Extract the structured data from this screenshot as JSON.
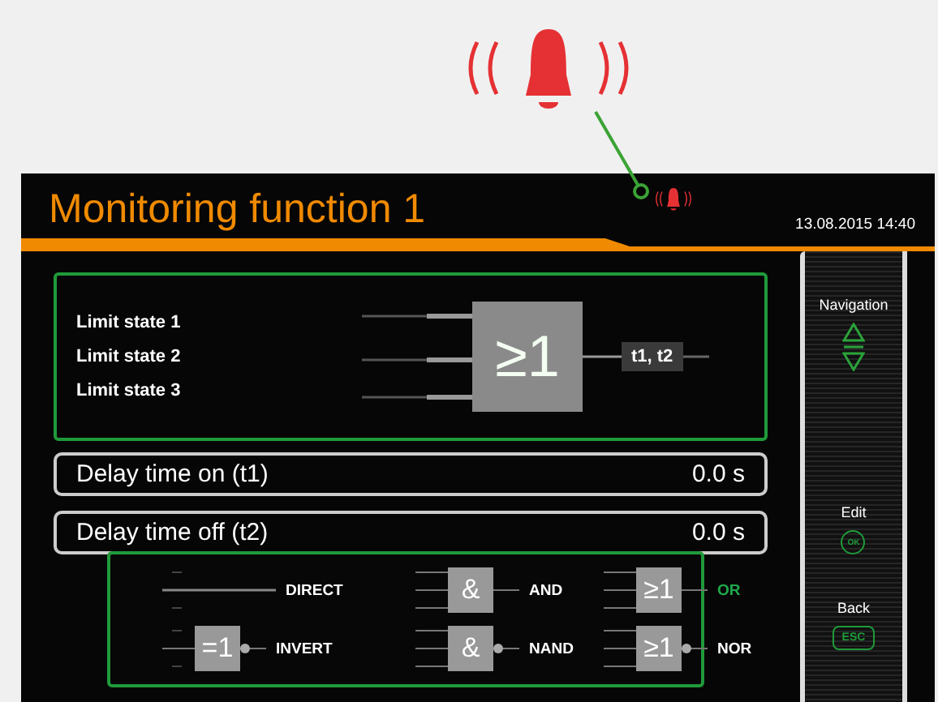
{
  "header": {
    "title": "Monitoring function 1",
    "datetime": "13.08.2015  14:40"
  },
  "logic": {
    "inputs": [
      "Limit state 1",
      "Limit state 2",
      "Limit state 3"
    ],
    "gate": "≥1",
    "output": "t1, t2"
  },
  "parameters": [
    {
      "label": "Delay time on (t1)",
      "value": "0.0 s"
    },
    {
      "label": "Delay time off (t2)",
      "value": "0.0 s"
    }
  ],
  "gate_menu": [
    {
      "kind": "direct",
      "label": "DIRECT",
      "selected": false
    },
    {
      "kind": "multi",
      "symbol": "&",
      "label": "AND",
      "negated": false,
      "selected": false
    },
    {
      "kind": "multi",
      "symbol": "≥1",
      "label": "OR",
      "negated": false,
      "selected": true
    },
    {
      "kind": "single",
      "symbol": "=1",
      "label": "INVERT",
      "negated": true,
      "selected": false
    },
    {
      "kind": "multi",
      "symbol": "&",
      "label": "NAND",
      "negated": true,
      "selected": false
    },
    {
      "kind": "multi",
      "symbol": "≥1",
      "label": "NOR",
      "negated": true,
      "selected": false
    }
  ],
  "sidebar": [
    {
      "kind": "arrows",
      "label": "Navigation"
    },
    {
      "kind": "circle",
      "label": "Edit",
      "key": "OK"
    },
    {
      "kind": "key",
      "label": "Back",
      "key": "ESC"
    }
  ]
}
